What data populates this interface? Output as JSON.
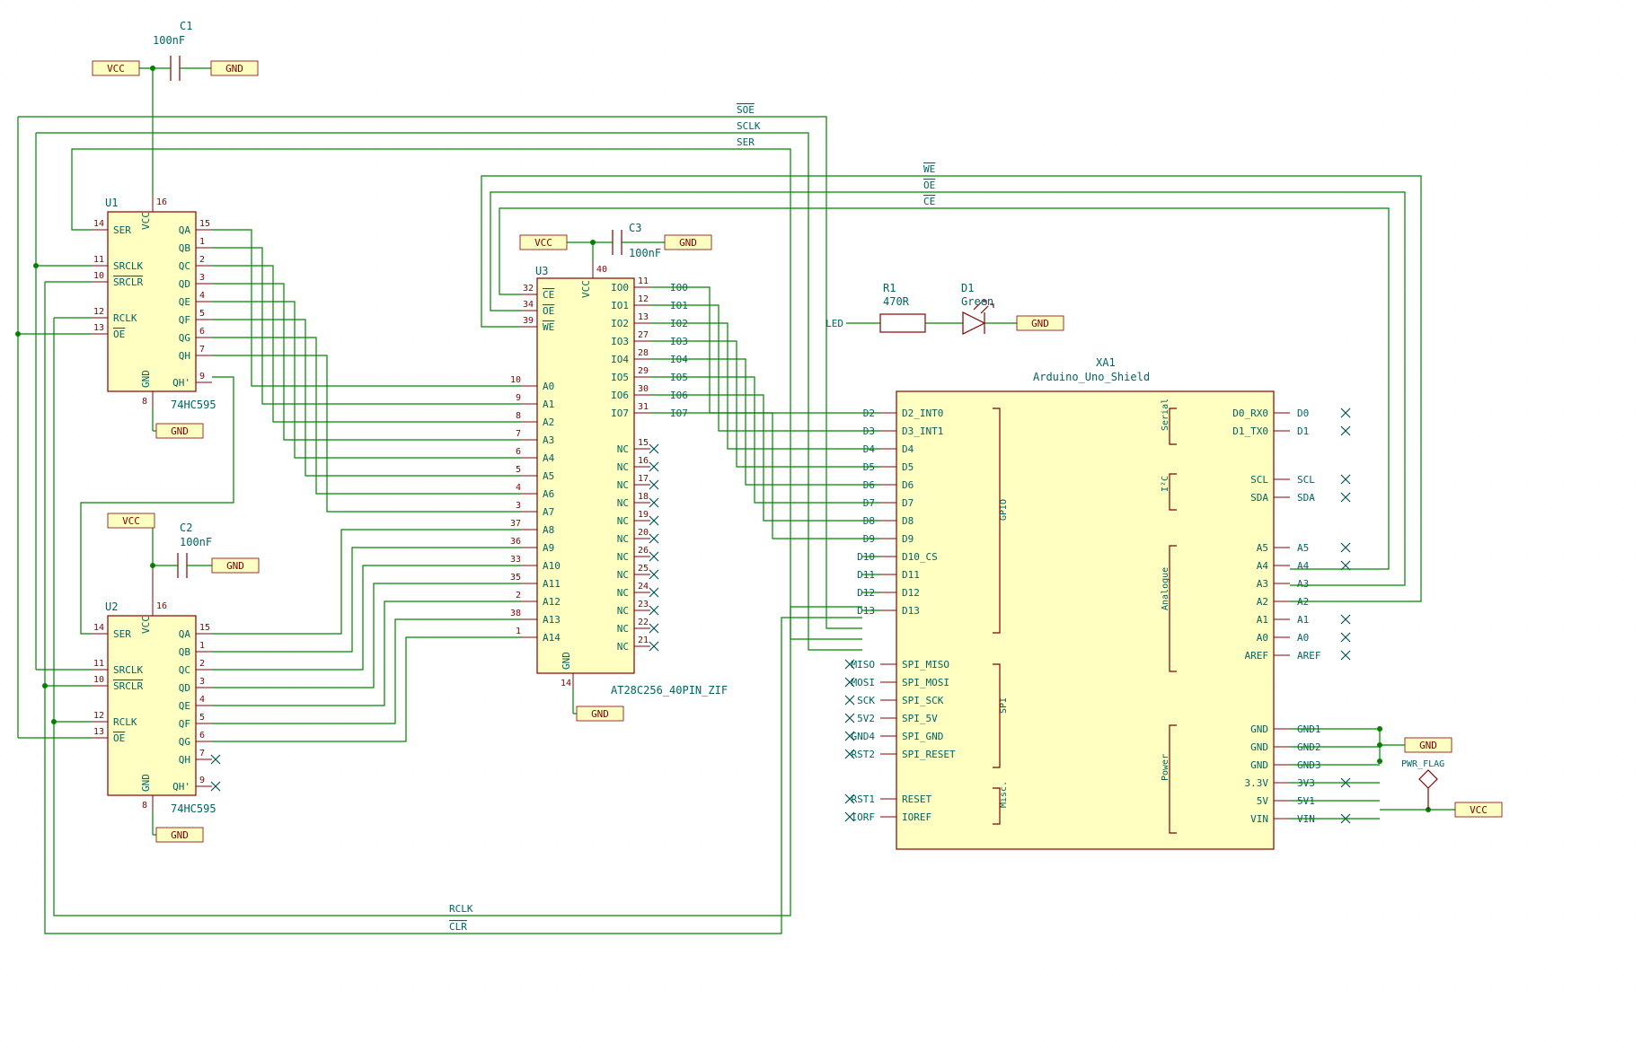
{
  "caps": {
    "c1": {
      "ref": "C1",
      "val": "100nF"
    },
    "c2": {
      "ref": "C2",
      "val": "100nF"
    },
    "c3": {
      "ref": "C3",
      "val": "100nF"
    }
  },
  "r1": {
    "ref": "R1",
    "val": "470R"
  },
  "d1": {
    "ref": "D1",
    "val": "Green"
  },
  "u1": {
    "ref": "U1",
    "type": "74HC595",
    "left": [
      {
        "pin": "14",
        "name": "SER"
      },
      {
        "pin": "11",
        "name": "SRCLK"
      },
      {
        "pin": "10",
        "name": "SRCLR",
        "bar": true
      },
      {
        "pin": "12",
        "name": "RCLK"
      },
      {
        "pin": "13",
        "name": "OE",
        "bar": true
      }
    ],
    "right": [
      {
        "pin": "15",
        "name": "QA"
      },
      {
        "pin": "1",
        "name": "QB"
      },
      {
        "pin": "2",
        "name": "QC"
      },
      {
        "pin": "3",
        "name": "QD"
      },
      {
        "pin": "4",
        "name": "QE"
      },
      {
        "pin": "5",
        "name": "QF"
      },
      {
        "pin": "6",
        "name": "QG"
      },
      {
        "pin": "7",
        "name": "QH"
      },
      {
        "pin": "9",
        "name": "QH'"
      }
    ],
    "vcc": "16",
    "gnd": "8"
  },
  "u2": {
    "ref": "U2",
    "type": "74HC595",
    "left": [
      {
        "pin": "14",
        "name": "SER"
      },
      {
        "pin": "11",
        "name": "SRCLK"
      },
      {
        "pin": "10",
        "name": "SRCLR",
        "bar": true
      },
      {
        "pin": "12",
        "name": "RCLK"
      },
      {
        "pin": "13",
        "name": "OE",
        "bar": true
      }
    ],
    "right": [
      {
        "pin": "15",
        "name": "QA"
      },
      {
        "pin": "1",
        "name": "QB"
      },
      {
        "pin": "2",
        "name": "QC"
      },
      {
        "pin": "3",
        "name": "QD"
      },
      {
        "pin": "4",
        "name": "QE"
      },
      {
        "pin": "5",
        "name": "QF"
      },
      {
        "pin": "6",
        "name": "QG"
      },
      {
        "pin": "7",
        "name": "QH"
      },
      {
        "pin": "9",
        "name": "QH'"
      }
    ],
    "vcc": "16",
    "gnd": "8"
  },
  "u3": {
    "ref": "U3",
    "type": "AT28C256_40PIN_ZIF",
    "vcc": "40",
    "gnd": "14",
    "left_top": [
      {
        "pin": "32",
        "name": "CE",
        "bar": true
      },
      {
        "pin": "34",
        "name": "OE",
        "bar": true
      },
      {
        "pin": "39",
        "name": "WE",
        "bar": true
      }
    ],
    "left_addr": [
      {
        "pin": "10",
        "name": "A0"
      },
      {
        "pin": "9",
        "name": "A1"
      },
      {
        "pin": "8",
        "name": "A2"
      },
      {
        "pin": "7",
        "name": "A3"
      },
      {
        "pin": "6",
        "name": "A4"
      },
      {
        "pin": "5",
        "name": "A5"
      },
      {
        "pin": "4",
        "name": "A6"
      },
      {
        "pin": "3",
        "name": "A7"
      },
      {
        "pin": "37",
        "name": "A8"
      },
      {
        "pin": "36",
        "name": "A9"
      },
      {
        "pin": "33",
        "name": "A10"
      },
      {
        "pin": "35",
        "name": "A11"
      },
      {
        "pin": "2",
        "name": "A12"
      },
      {
        "pin": "38",
        "name": "A13"
      },
      {
        "pin": "1",
        "name": "A14"
      }
    ],
    "right_io": [
      {
        "pin": "11",
        "name": "IO0"
      },
      {
        "pin": "12",
        "name": "IO1"
      },
      {
        "pin": "13",
        "name": "IO2"
      },
      {
        "pin": "27",
        "name": "IO3"
      },
      {
        "pin": "28",
        "name": "IO4"
      },
      {
        "pin": "29",
        "name": "IO5"
      },
      {
        "pin": "30",
        "name": "IO6"
      },
      {
        "pin": "31",
        "name": "IO7"
      }
    ],
    "right_nc": [
      {
        "pin": "15",
        "name": "NC"
      },
      {
        "pin": "16",
        "name": "NC"
      },
      {
        "pin": "17",
        "name": "NC"
      },
      {
        "pin": "18",
        "name": "NC"
      },
      {
        "pin": "19",
        "name": "NC"
      },
      {
        "pin": "20",
        "name": "NC"
      },
      {
        "pin": "26",
        "name": "NC"
      },
      {
        "pin": "25",
        "name": "NC"
      },
      {
        "pin": "24",
        "name": "NC"
      },
      {
        "pin": "23",
        "name": "NC"
      },
      {
        "pin": "22",
        "name": "NC"
      },
      {
        "pin": "21",
        "name": "NC"
      }
    ],
    "io_nets": [
      "IO0",
      "IO1",
      "IO2",
      "IO3",
      "IO4",
      "IO5",
      "IO6",
      "IO7"
    ]
  },
  "xa1": {
    "ref": "XA1",
    "type": "Arduino_Uno_Shield",
    "gpio": [
      {
        "name": "D2_INT0",
        "net": "D2"
      },
      {
        "name": "D3_INT1",
        "net": "D3"
      },
      {
        "name": "D4",
        "net": "D4"
      },
      {
        "name": "D5",
        "net": "D5"
      },
      {
        "name": "D6",
        "net": "D6"
      },
      {
        "name": "D7",
        "net": "D7"
      },
      {
        "name": "D8",
        "net": "D8"
      },
      {
        "name": "D9",
        "net": "D9"
      },
      {
        "name": "D10_CS",
        "net": "D10"
      },
      {
        "name": "D11",
        "net": "D11"
      },
      {
        "name": "D12",
        "net": "D12"
      },
      {
        "name": "D13",
        "net": "D13"
      }
    ],
    "spi": [
      {
        "name": "SPI_MISO",
        "net": "MISO"
      },
      {
        "name": "SPI_MOSI",
        "net": "MOSI"
      },
      {
        "name": "SPI_SCK",
        "net": "SCK"
      },
      {
        "name": "SPI_5V",
        "net": "5V2"
      },
      {
        "name": "SPI_GND",
        "net": "GND4"
      },
      {
        "name": "SPI_RESET",
        "net": "RST2"
      }
    ],
    "misc": [
      {
        "name": "RESET",
        "net": "RST1"
      },
      {
        "name": "IOREF",
        "net": "IORF"
      }
    ],
    "serial": [
      {
        "name": "D0_RX0",
        "net": "D0"
      },
      {
        "name": "D1_TX0",
        "net": "D1"
      }
    ],
    "i2c": [
      {
        "name": "SCL",
        "net": "SCL"
      },
      {
        "name": "SDA",
        "net": "SDA"
      }
    ],
    "analogue": [
      {
        "name": "A5",
        "net": "A5"
      },
      {
        "name": "A4",
        "net": "A4"
      },
      {
        "name": "A3",
        "net": "A3"
      },
      {
        "name": "A2",
        "net": "A2"
      },
      {
        "name": "A1",
        "net": "A1"
      },
      {
        "name": "A0",
        "net": "A0"
      },
      {
        "name": "AREF",
        "net": "AREF"
      }
    ],
    "power": [
      {
        "name": "GND",
        "net": "GND1"
      },
      {
        "name": "GND",
        "net": "GND2"
      },
      {
        "name": "GND",
        "net": "GND3"
      },
      {
        "name": "3.3V",
        "net": "3V3"
      },
      {
        "name": "5V",
        "net": "5V1"
      },
      {
        "name": "VIN",
        "net": "VIN"
      }
    ],
    "sideGPIO": "GPIO",
    "sideSerial": "Serial",
    "sideI2C": "I²C",
    "sideAnalogue": "Analogue",
    "sideSPI": "SPI",
    "sideMisc": "Misc.",
    "sidePower": "Power"
  },
  "bus_labels": {
    "top": [
      {
        "text": "SOE",
        "bar": true
      },
      {
        "text": "SCLK",
        "bar": false
      },
      {
        "text": "SER",
        "bar": false
      }
    ],
    "right": [
      {
        "text": "WE",
        "bar": true
      },
      {
        "text": "OE",
        "bar": true
      },
      {
        "text": "CE",
        "bar": true
      }
    ],
    "bottom": [
      {
        "text": "RCLK",
        "bar": false
      },
      {
        "text": "CLR",
        "bar": true
      }
    ]
  },
  "led_net": "LED",
  "pwr": {
    "vcc": "VCC",
    "gnd": "GND"
  },
  "pwr_flag": "PWR_FLAG"
}
